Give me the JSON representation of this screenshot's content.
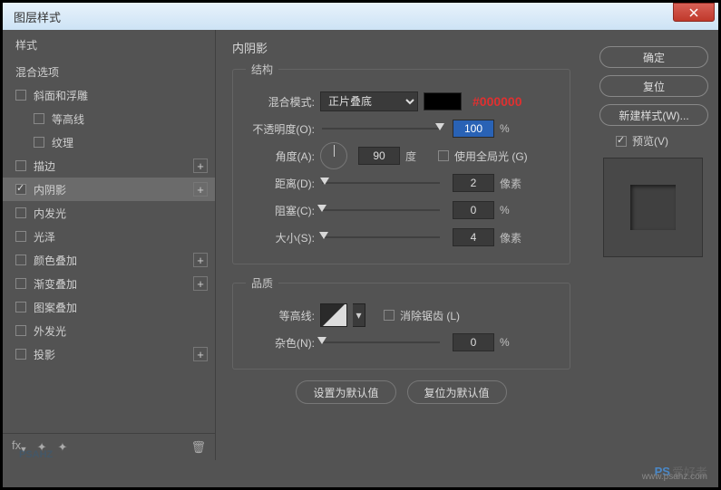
{
  "window": {
    "title": "图层样式"
  },
  "sidebar": {
    "header": "样式",
    "blending": "混合选项",
    "effects": [
      {
        "label": "斜面和浮雕",
        "checked": false,
        "reveal": false,
        "indent": false
      },
      {
        "label": "等高线",
        "checked": false,
        "reveal": false,
        "indent": true
      },
      {
        "label": "纹理",
        "checked": false,
        "reveal": false,
        "indent": true
      },
      {
        "label": "描边",
        "checked": false,
        "reveal": true,
        "indent": false
      },
      {
        "label": "内阴影",
        "checked": true,
        "reveal": true,
        "indent": false,
        "selected": true
      },
      {
        "label": "内发光",
        "checked": false,
        "reveal": false,
        "indent": false
      },
      {
        "label": "光泽",
        "checked": false,
        "reveal": false,
        "indent": false
      },
      {
        "label": "颜色叠加",
        "checked": false,
        "reveal": true,
        "indent": false
      },
      {
        "label": "渐变叠加",
        "checked": false,
        "reveal": true,
        "indent": false
      },
      {
        "label": "图案叠加",
        "checked": false,
        "reveal": false,
        "indent": false
      },
      {
        "label": "外发光",
        "checked": false,
        "reveal": false,
        "indent": false
      },
      {
        "label": "投影",
        "checked": false,
        "reveal": true,
        "indent": false
      }
    ]
  },
  "panel": {
    "title": "内阴影",
    "structure": {
      "legend": "结构",
      "blendModeLabel": "混合模式:",
      "blendModeValue": "正片叠底",
      "colorHex": "#000000",
      "opacityLabel": "不透明度(O):",
      "opacityValue": "100",
      "opacityUnit": "%",
      "angleLabel": "角度(A):",
      "angleValue": "90",
      "angleUnit": "度",
      "globalLightLabel": "使用全局光 (G)",
      "distanceLabel": "距离(D):",
      "distanceValue": "2",
      "distanceUnit": "像素",
      "chokeLabel": "阻塞(C):",
      "chokeValue": "0",
      "chokeUnit": "%",
      "sizeLabel": "大小(S):",
      "sizeValue": "4",
      "sizeUnit": "像素"
    },
    "quality": {
      "legend": "品质",
      "contourLabel": "等高线:",
      "antiAliasLabel": "消除锯齿 (L)",
      "noiseLabel": "杂色(N):",
      "noiseValue": "0",
      "noiseUnit": "%"
    },
    "defaultBtn": "设置为默认值",
    "resetBtn": "复位为默认值"
  },
  "buttons": {
    "ok": "确定",
    "cancel": "复位",
    "newStyle": "新建样式(W)...",
    "preview": "预览(V)"
  },
  "footer": {
    "fx": "fx"
  },
  "watermark": {
    "brand": "PS",
    "text": "爱好者",
    "url": "www.psahz.com"
  }
}
